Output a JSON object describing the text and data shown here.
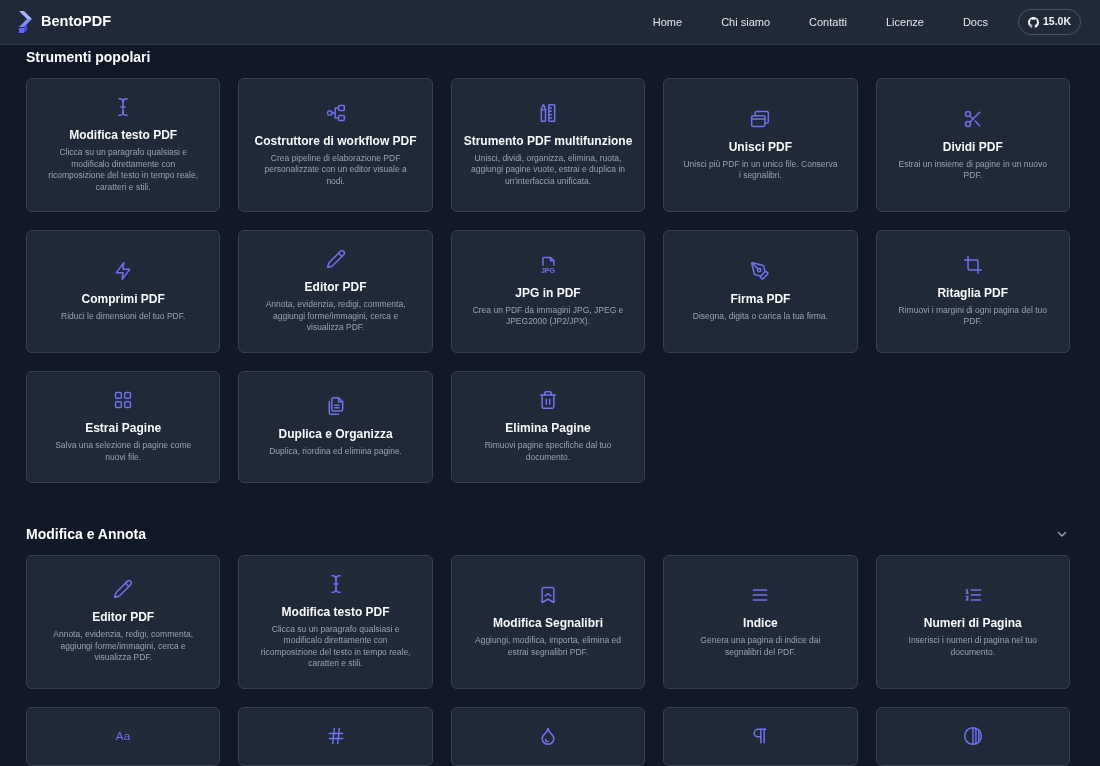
{
  "navbar": {
    "brand": "BentoPDF",
    "links": [
      "Home",
      "Chi siamo",
      "Contatti",
      "Licenze",
      "Docs"
    ],
    "github_stars": "15.0K"
  },
  "sections": [
    {
      "title": "Strumenti popolari",
      "tools": [
        {
          "kind": "cursor",
          "title": "Modifica testo PDF",
          "description": "Clicca su un paragrafo qualsiasi e modificalo direttamente con ricomposizione del testo in tempo reale, caratteri e stili."
        },
        {
          "kind": "workflow",
          "title": "Costruttore di workflow PDF",
          "description": "Crea pipeline di elaborazione PDF personalizzate con un editor visuale a nodi."
        },
        {
          "kind": "multitool",
          "title": "Strumento PDF multifunzione",
          "description": "Unisci, dividi, organizza, elimina, ruota, aggiungi pagine vuote, estrai e duplica in un'interfaccia unificata."
        },
        {
          "kind": "merge",
          "title": "Unisci PDF",
          "description": "Unisci più PDF in un unico file. Conserva i segnalibri."
        },
        {
          "kind": "split",
          "title": "Dividi PDF",
          "description": "Estrai un insieme di pagine in un nuovo PDF."
        },
        {
          "kind": "compress",
          "title": "Comprimi PDF",
          "description": "Riduci le dimensioni del tuo PDF."
        },
        {
          "kind": "editor",
          "title": "Editor PDF",
          "description": "Annota, evidenzia, redigi, commenta, aggiungi forme/immagini, cerca e visualizza PDF."
        },
        {
          "kind": "jpg",
          "icon_text": "JPG",
          "title": "JPG in PDF",
          "description": "Crea un PDF da immagini JPG, JPEG e JPEG2000 (JP2/JPX)."
        },
        {
          "kind": "sign",
          "title": "Firma PDF",
          "description": "Disegna, digita o carica la tua firma."
        },
        {
          "kind": "crop",
          "title": "Ritaglia PDF",
          "description": "Rimuovi i margini di ogni pagina del tuo PDF."
        },
        {
          "kind": "extract",
          "title": "Estrai Pagine",
          "description": "Salva una selezione di pagine come nuovi file."
        },
        {
          "kind": "duplicate",
          "title": "Duplica e Organizza",
          "description": "Duplica, riordina ed elimina pagine."
        },
        {
          "kind": "delete",
          "title": "Elimina Pagine",
          "description": "Rimuovi pagine specifiche dal tuo documento."
        }
      ]
    },
    {
      "title": "Modifica e Annota",
      "expanded": true,
      "tools": [
        {
          "kind": "editor",
          "title": "Editor PDF",
          "description": "Annota, evidenzia, redigi, commenta, aggiungi forme/immagini, cerca e visualizza PDF."
        },
        {
          "kind": "cursor",
          "title": "Modifica testo PDF",
          "description": "Clicca su un paragrafo qualsiasi e modificalo direttamente con ricomposizione del testo in tempo reale, caratteri e stili."
        },
        {
          "kind": "bookmarks",
          "title": "Modifica Segnalibri",
          "description": "Aggiungi, modifica, importa, elimina ed estrai segnalibri PDF."
        },
        {
          "kind": "index",
          "title": "Indice",
          "description": "Genera una pagina di indice dai segnalibri del PDF."
        },
        {
          "kind": "numbering",
          "title": "Numeri di Pagina",
          "description": "Inserisci i numeri di pagina nel tuo documento."
        },
        {
          "kind": "font",
          "icon_text": "Aa"
        },
        {
          "kind": "hash"
        },
        {
          "kind": "droplet"
        },
        {
          "kind": "pilcrow"
        },
        {
          "kind": "contrast"
        }
      ]
    }
  ]
}
